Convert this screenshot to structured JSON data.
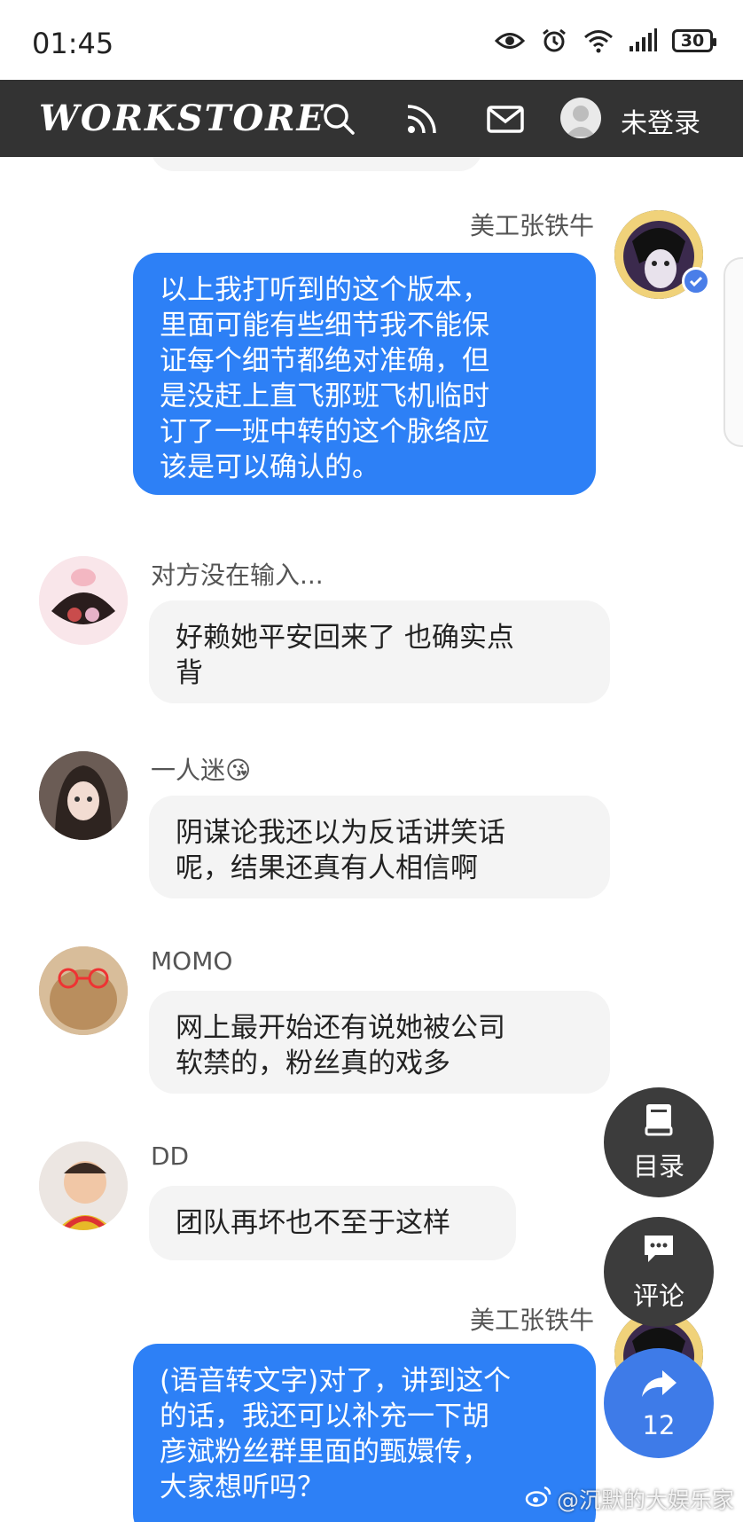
{
  "status_bar": {
    "time": "01:45",
    "battery": "30",
    "icons": [
      "eye-icon",
      "alarm-icon",
      "wifi-icon",
      "signal-icon",
      "battery-icon"
    ]
  },
  "navbar": {
    "logo": "WORKSTORE",
    "login_label": "未登录",
    "icons": [
      "search-icon",
      "rss-icon",
      "mail-icon",
      "user-avatar-icon"
    ]
  },
  "messages": [
    {
      "sender": "美工张铁牛",
      "side": "right",
      "text": "以上我打听到的这个版本，\n里面可能有些细节我不能保\n证每个细节都绝对准确，但\n是没赶上直飞那班飞机临时\n订了一班中转的这个脉络应\n该是可以确认的。"
    },
    {
      "sender": "对方没在输入...",
      "side": "left",
      "text": "好赖她平安回来了 也确实点\n背"
    },
    {
      "sender": "一人迷",
      "side": "left",
      "text": "阴谋论我还以为反话讲笑话\n呢，结果还真有人相信啊"
    },
    {
      "sender": "MOMO",
      "side": "left",
      "text": "网上最开始还有说她被公司\n软禁的，粉丝真的戏多"
    },
    {
      "sender": "DD",
      "side": "left",
      "text": "团队再坏也不至于这样"
    },
    {
      "sender": "美工张铁牛",
      "side": "right",
      "text": "(语音转文字)对了，讲到这个\n的话，我还可以补充一下胡\n彦斌粉丝群里面的甄嬛传，\n大家想听吗？"
    }
  ],
  "emoji_after_name": "😘",
  "fabs": {
    "catalog_label": "目录",
    "comment_label": "评论",
    "share_count": "12"
  },
  "watermark": "@沉默的大娱乐家",
  "colors": {
    "navbar_bg": "#333333",
    "bubble_blue": "#2d80f6",
    "bubble_gray": "#f4f4f4",
    "fab_dark": "#3c3c3c",
    "fab_blue": "#3e7be8"
  }
}
